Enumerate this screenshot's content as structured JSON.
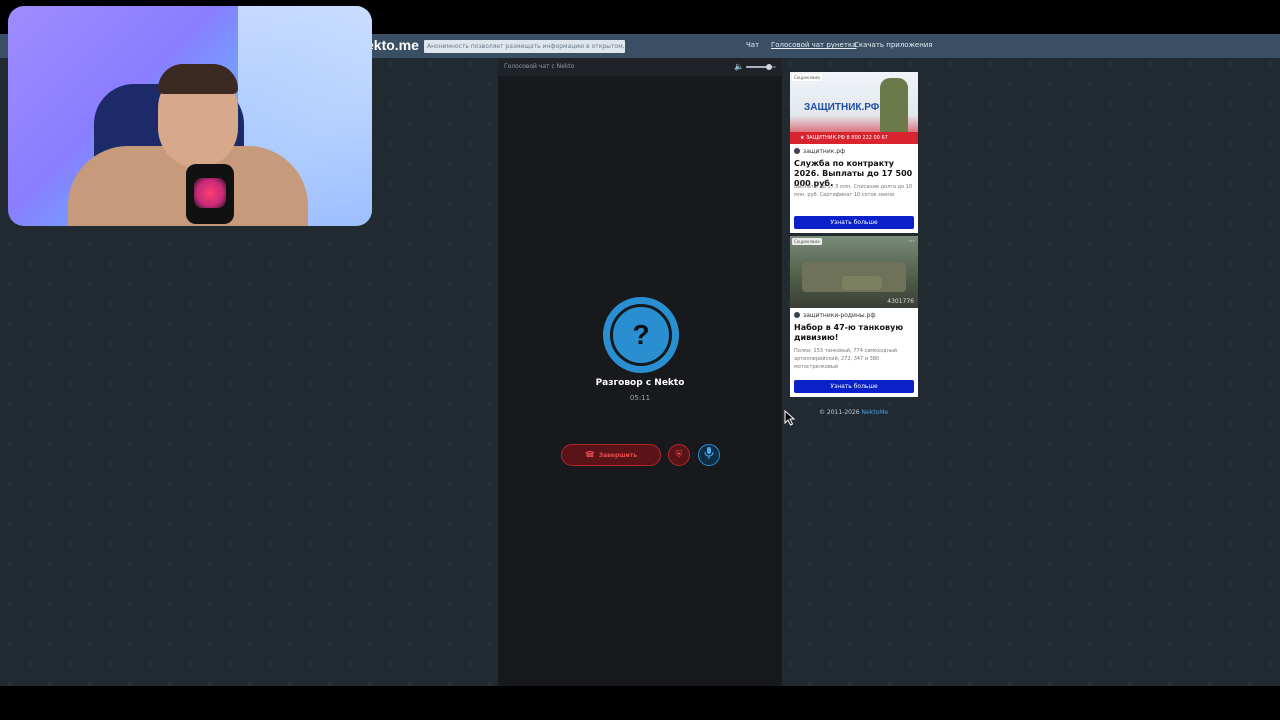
{
  "topbar": {
    "logo": "ekto.me",
    "notice": "Анонимность позволяет размещать информацию в открытом, сыром виде!",
    "links": {
      "chat": "Чат",
      "voice": "Голосовой чат рунетка",
      "apps": "Скачать приложения"
    }
  },
  "call": {
    "header_title": "Голосовой чат с Nekto",
    "avatar_symbol": "?",
    "name": "Разговор с Nekto",
    "timer": "05:11",
    "end_label": "Завершить",
    "volume_level": 0.75,
    "icons": {
      "volume": "speaker-icon",
      "end": "phone-hangup-icon",
      "report": "shield-icon",
      "mic": "microphone-icon"
    }
  },
  "ads": [
    {
      "tag": "Соцреклама",
      "brand": "ЗАЩИТНИК.РФ",
      "strip": "★ ЗАЩИТНИК.РФ  8 800 222 00 67",
      "domain": "защитник.рф",
      "title": "Служба по контракту 2026. Выплаты до 17 500 000 руб.",
      "description": "Выплаты до 17,5 млн. Списание долга до 10 млн. руб. Сертификат 10 соток земли",
      "button": "Узнать больше"
    },
    {
      "tag": "Соцреклама",
      "number": "4301776",
      "domain": "защитники-родины.рф",
      "title": "Набор в 47-ю танковую дивизию!",
      "description": "Полки: 153 танковый, 774 самоходный артиллерийский, 272, 347 и 380 мотострелковый",
      "button": "Узнать больше"
    }
  ],
  "footer": {
    "copyright": "© 2011-2026",
    "link": "NektoMe"
  },
  "colors": {
    "accent_blue": "#2a8fd0",
    "end_red": "#e84a50",
    "ad_button": "#0a20c8",
    "topbar": "#3a4f63"
  }
}
